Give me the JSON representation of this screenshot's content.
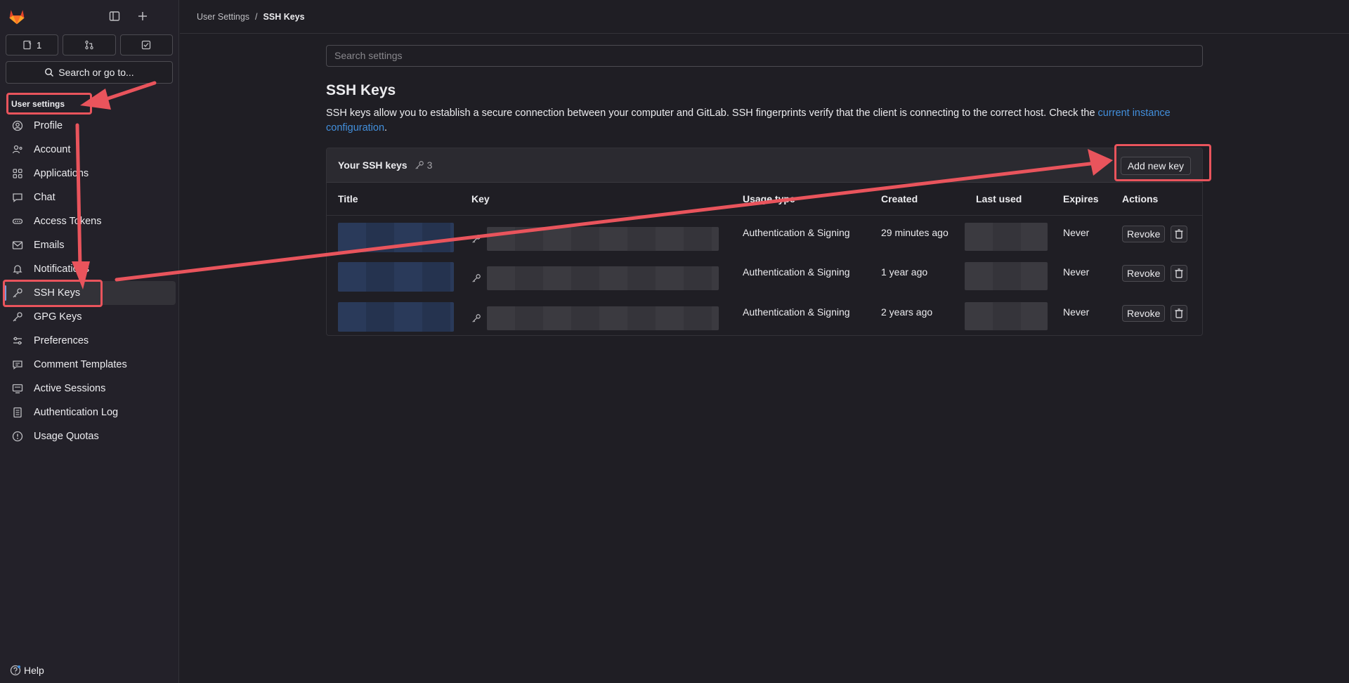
{
  "sidebar": {
    "counters": [
      {
        "icon": "issues-icon",
        "label": "1"
      },
      {
        "icon": "merge-request-icon",
        "label": ""
      },
      {
        "icon": "todo-icon",
        "label": ""
      }
    ],
    "search_label": "Search or go to...",
    "heading": "User settings",
    "items": [
      {
        "id": "profile",
        "label": "Profile",
        "icon": "profile-icon"
      },
      {
        "id": "account",
        "label": "Account",
        "icon": "account-icon"
      },
      {
        "id": "applications",
        "label": "Applications",
        "icon": "applications-icon"
      },
      {
        "id": "chat",
        "label": "Chat",
        "icon": "chat-icon"
      },
      {
        "id": "access-tokens",
        "label": "Access Tokens",
        "icon": "token-icon"
      },
      {
        "id": "emails",
        "label": "Emails",
        "icon": "mail-icon"
      },
      {
        "id": "notifications",
        "label": "Notifications",
        "icon": "bell-icon"
      },
      {
        "id": "ssh-keys",
        "label": "SSH Keys",
        "icon": "key-icon"
      },
      {
        "id": "gpg-keys",
        "label": "GPG Keys",
        "icon": "key-icon"
      },
      {
        "id": "preferences",
        "label": "Preferences",
        "icon": "preferences-icon"
      },
      {
        "id": "comment-templates",
        "label": "Comment Templates",
        "icon": "comment-icon"
      },
      {
        "id": "active-sessions",
        "label": "Active Sessions",
        "icon": "monitor-icon"
      },
      {
        "id": "authentication-log",
        "label": "Authentication Log",
        "icon": "log-icon"
      },
      {
        "id": "usage-quotas",
        "label": "Usage Quotas",
        "icon": "quota-icon"
      }
    ],
    "help_label": "Help"
  },
  "breadcrumb": {
    "parent": "User Settings",
    "separator": "/",
    "current": "SSH Keys"
  },
  "search": {
    "placeholder": "Search settings"
  },
  "page": {
    "title": "SSH Keys",
    "description": "SSH keys allow you to establish a secure connection between your computer and GitLab. SSH fingerprints verify that the client is connecting to the correct host. Check the ",
    "link_text": "current instance configuration",
    "description_end": "."
  },
  "keys_card": {
    "title": "Your SSH keys",
    "count": "3",
    "add_button": "Add new key",
    "columns": [
      "Title",
      "Key",
      "Usage type",
      "Created",
      "Last used",
      "Expires",
      "Actions"
    ],
    "rows": [
      {
        "usage": "Authentication & Signing",
        "created": "29 minutes ago",
        "expires": "Never",
        "revoke": "Revoke"
      },
      {
        "usage": "Authentication & Signing",
        "created": "1 year ago",
        "expires": "Never",
        "revoke": "Revoke"
      },
      {
        "usage": "Authentication & Signing",
        "created": "2 years ago",
        "expires": "Never",
        "revoke": "Revoke"
      }
    ]
  },
  "colors": {
    "accent": "#428fdc",
    "annotation": "#e9545c",
    "logo_orange": "#e24329"
  }
}
